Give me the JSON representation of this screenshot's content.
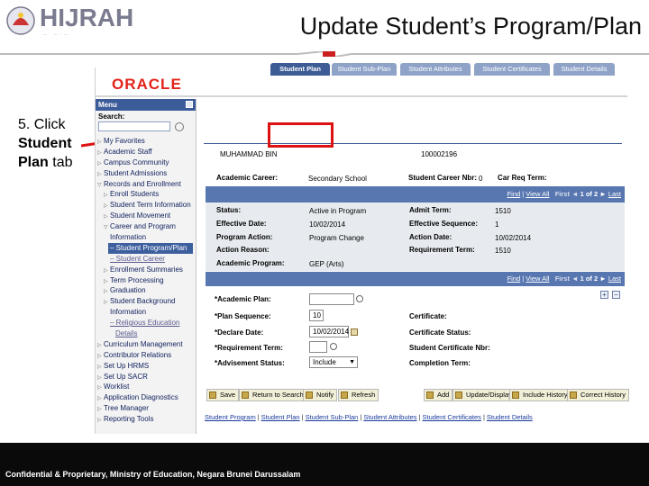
{
  "slide": {
    "logo_text": "HIJRAH",
    "title": "Update Student’s Program/Plan",
    "instruction_prefix": "5. Click",
    "instruction_bold": "Student Plan",
    "instruction_suffix": "tab",
    "footer": "Confidential & Proprietary, Ministry of Education, Negara Brunei Darussalam",
    "colors": {
      "rule_red": "#cc1f1f",
      "rule_grey": "#bcbcbc",
      "footer_bg": "#0a0a0a",
      "highlight": "#dd1111"
    }
  },
  "oracle": {
    "logo": "ORACLE"
  },
  "menu": {
    "title": "Menu",
    "search_label": "Search:",
    "items": [
      {
        "label": "My Favorites",
        "level": "top"
      },
      {
        "label": "Academic Staff",
        "level": "top"
      },
      {
        "label": "Campus Community",
        "level": "top"
      },
      {
        "label": "Student Admissions",
        "level": "top"
      },
      {
        "label": "Records and Enrollment",
        "level": "top-open"
      },
      {
        "label": "Enroll Students",
        "level": "sub"
      },
      {
        "label": "Student Term Information",
        "level": "sub"
      },
      {
        "label": "Student Movement",
        "level": "sub"
      },
      {
        "label": "Career and Program",
        "level": "sub-open"
      },
      {
        "label": "Information",
        "level": "cont"
      },
      {
        "label": "– Student Program/Plan",
        "level": "selected"
      },
      {
        "label": "– Student Career",
        "level": "link"
      },
      {
        "label": "Enrollment Summaries",
        "level": "sub"
      },
      {
        "label": "Term Processing",
        "level": "sub"
      },
      {
        "label": "Graduation",
        "level": "sub"
      },
      {
        "label": "Student Background",
        "level": "sub"
      },
      {
        "label": "Information",
        "level": "cont"
      },
      {
        "label": "– Religious Education",
        "level": "link"
      },
      {
        "label": "Details",
        "level": "linkc"
      },
      {
        "label": "Curriculum Management",
        "level": "top"
      },
      {
        "label": "Contributor Relations",
        "level": "top"
      },
      {
        "label": "Set Up HRMS",
        "level": "top"
      },
      {
        "label": "Set Up SACR",
        "level": "top"
      },
      {
        "label": "Worklist",
        "level": "top"
      },
      {
        "label": "Application Diagnostics",
        "level": "top"
      },
      {
        "label": "Tree Manager",
        "level": "top"
      },
      {
        "label": "Reporting Tools",
        "level": "top"
      }
    ]
  },
  "tabs": [
    "Student Plan",
    "Student Sub-Plan",
    "Student Attributes",
    "Student Certificates",
    "Student Details"
  ],
  "student": {
    "name": "MUHAMMAD BIN",
    "id": "100002196"
  },
  "career": {
    "academic_career_label": "Academic Career:",
    "academic_career_value": "Secondary School",
    "career_nbr_label": "Student Career Nbr:",
    "career_nbr_value": "0",
    "car_req_term_label": "Car Req Term:"
  },
  "nav": {
    "find": "Find",
    "view_all": "View All",
    "first": "First",
    "count": "1 of 2",
    "last": "Last"
  },
  "program": {
    "status_label": "Status:",
    "status_value": "Active in Program",
    "effective_date_label": "Effective Date:",
    "effective_date_value": "10/02/2014",
    "program_action_label": "Program Action:",
    "program_action_value": "Program Change",
    "action_reason_label": "Action Reason:",
    "academic_program_label": "Academic Program:",
    "academic_program_value": "GEP (Arts)",
    "admit_term_label": "Admit Term:",
    "admit_term_value": "1510",
    "effective_sequence_label": "Effective Sequence:",
    "effective_sequence_value": "1",
    "action_date_label": "Action Date:",
    "action_date_value": "10/02/2014",
    "requirement_term_label": "Requirement Term:",
    "requirement_term_value": "1510"
  },
  "nav2": {
    "find": "Find",
    "view_all": "View All",
    "first": "First",
    "count": "1 of 2",
    "last": "Last"
  },
  "plan": {
    "academic_plan_label": "*Academic Plan:",
    "plan_sequence_label": "*Plan Sequence:",
    "plan_sequence_value": "10",
    "declare_date_label": "*Declare Date:",
    "declare_date_value": "10/02/2014",
    "requirement_term_label": "*Requirement Term:",
    "advisement_status_label": "*Advisement Status:",
    "advisement_status_value": "Include",
    "certificate_label": "Certificate:",
    "certificate_status_label": "Certificate Status:",
    "student_certificate_nbr_label": "Student Certificate Nbr:",
    "completion_term_label": "Completion Term:"
  },
  "toolbar": {
    "save": "Save",
    "return_to_search": "Return to Search",
    "notify": "Notify",
    "refresh": "Refresh",
    "add": "Add",
    "update_display": "Update/Display",
    "include_history": "Include History",
    "correct_history": "Correct History"
  },
  "bottom_links": [
    "Student Program",
    "Student Plan",
    "Student Sub-Plan",
    "Student Attributes",
    "Student Certificates",
    "Student Details"
  ]
}
